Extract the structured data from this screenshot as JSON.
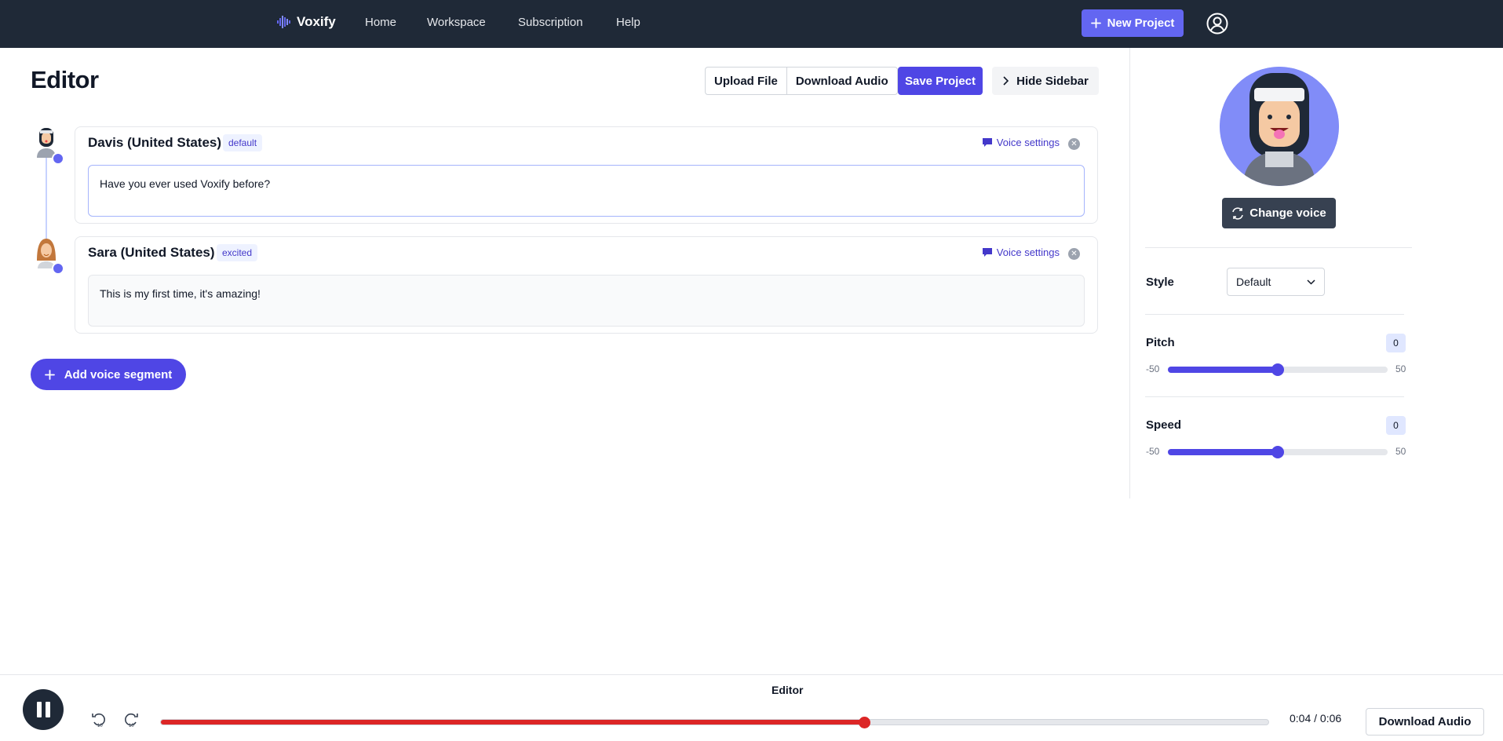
{
  "nav": {
    "brand": "Voxify",
    "links": [
      "Home",
      "Workspace",
      "Subscription",
      "Help"
    ],
    "new_project": "New Project",
    "user_icon": "user-circle-icon"
  },
  "editor": {
    "title": "Editor",
    "upload": "Upload File",
    "download": "Download Audio",
    "save": "Save Project",
    "hide_sidebar": "Hide Sidebar",
    "add_segment": "Add voice segment"
  },
  "segments": [
    {
      "voice": "Davis (United States)",
      "style": "default",
      "settings": "Voice settings",
      "text": "Have you ever used Voxify before?"
    },
    {
      "voice": "Sara (United States)",
      "style": "excited",
      "settings": "Voice settings",
      "text": "This is my first time, it's amazing!"
    }
  ],
  "sidebar": {
    "change_voice": "Change voice",
    "style_label": "Style",
    "style_value": "Default",
    "pitch_label": "Pitch",
    "pitch_value": "0",
    "speed_label": "Speed",
    "speed_value": "0",
    "range_min": "-50",
    "range_max": "50",
    "pitch": 0,
    "speed": 0
  },
  "player": {
    "title": "Editor",
    "time": "0:04 / 0:06",
    "download": "Download Audio",
    "progress": 0.635
  },
  "colors": {
    "nav_bg": "#1f2937",
    "accent": "#4f46e5",
    "accent_light": "#6366f1",
    "progress": "#dc2626"
  }
}
